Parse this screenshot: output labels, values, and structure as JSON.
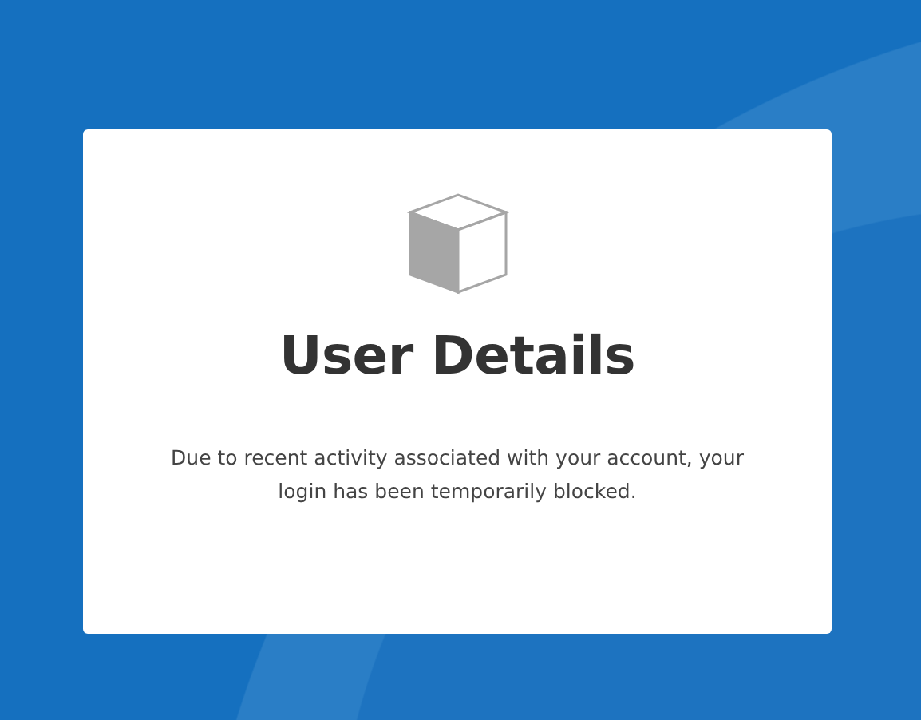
{
  "card": {
    "title": "User Details",
    "message": "Due to recent activity associated with your account, your login has been temporarily blocked."
  }
}
